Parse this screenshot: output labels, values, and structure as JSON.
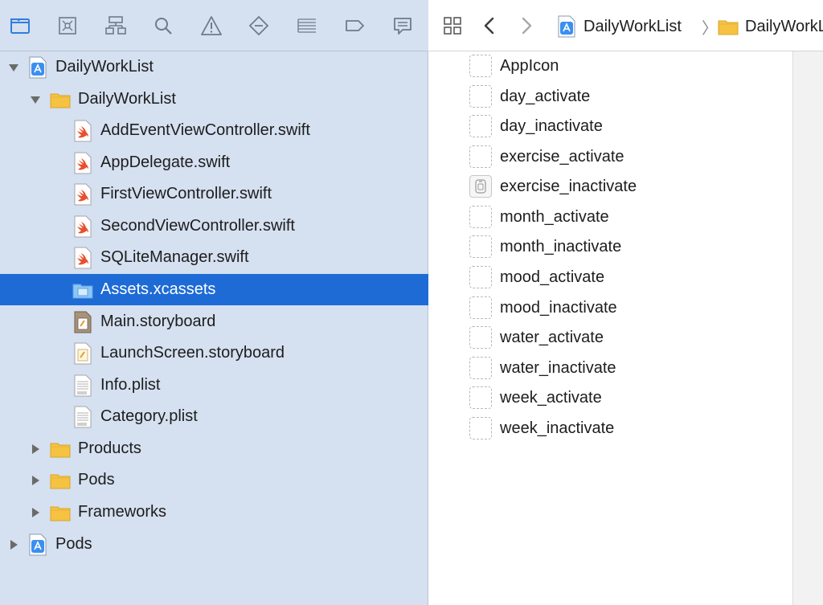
{
  "navigator": {
    "toolbar_icons": [
      "folder-icon",
      "source-control-icon",
      "hierarchy-icon",
      "search-icon",
      "warning-icon",
      "test-icon",
      "debug-icon",
      "breakpoint-icon",
      "report-icon"
    ],
    "tree": [
      {
        "label": "DailyWorkList",
        "icon": "xcode-project-icon",
        "disclosure": "expanded",
        "level": 0
      },
      {
        "label": "DailyWorkList",
        "icon": "folder-icon",
        "disclosure": "expanded",
        "level": 1
      },
      {
        "label": "AddEventViewController.swift",
        "icon": "swift-file-icon",
        "level": 2
      },
      {
        "label": "AppDelegate.swift",
        "icon": "swift-file-icon",
        "level": 2
      },
      {
        "label": "FirstViewController.swift",
        "icon": "swift-file-icon",
        "level": 2
      },
      {
        "label": "SecondViewController.swift",
        "icon": "swift-file-icon",
        "level": 2
      },
      {
        "label": "SQLiteManager.swift",
        "icon": "swift-file-icon",
        "level": 2
      },
      {
        "label": "Assets.xcassets",
        "icon": "asset-catalog-icon",
        "level": 2,
        "selected": true
      },
      {
        "label": "Main.storyboard",
        "icon": "storyboard-icon",
        "level": 2
      },
      {
        "label": "LaunchScreen.storyboard",
        "icon": "launch-storyboard-icon",
        "level": 2
      },
      {
        "label": "Info.plist",
        "icon": "plist-icon",
        "level": 2
      },
      {
        "label": "Category.plist",
        "icon": "plist-icon",
        "level": 2
      },
      {
        "label": "Products",
        "icon": "folder-icon",
        "disclosure": "collapsed",
        "level": 1
      },
      {
        "label": "Pods",
        "icon": "folder-icon",
        "disclosure": "collapsed",
        "level": 1
      },
      {
        "label": "Frameworks",
        "icon": "folder-icon",
        "disclosure": "collapsed",
        "level": 1
      },
      {
        "label": "Pods",
        "icon": "xcode-project-icon",
        "disclosure": "collapsed",
        "level": 0
      }
    ]
  },
  "jumpbar": {
    "crumbs": [
      {
        "label": "DailyWorkList",
        "icon": "xcode-project-icon"
      },
      {
        "label": "DailyWorkList",
        "icon": "folder-icon"
      }
    ],
    "separator": "〉"
  },
  "assets": [
    {
      "name": "AppIcon",
      "thumb": "empty"
    },
    {
      "name": "day_activate",
      "thumb": "empty"
    },
    {
      "name": "day_inactivate",
      "thumb": "empty"
    },
    {
      "name": "exercise_activate",
      "thumb": "empty"
    },
    {
      "name": "exercise_inactivate",
      "thumb": "image"
    },
    {
      "name": "month_activate",
      "thumb": "empty"
    },
    {
      "name": "month_inactivate",
      "thumb": "empty"
    },
    {
      "name": "mood_activate",
      "thumb": "empty"
    },
    {
      "name": "mood_inactivate",
      "thumb": "empty"
    },
    {
      "name": "water_activate",
      "thumb": "empty"
    },
    {
      "name": "water_inactivate",
      "thumb": "empty"
    },
    {
      "name": "week_activate",
      "thumb": "empty"
    },
    {
      "name": "week_inactivate",
      "thumb": "empty"
    }
  ],
  "colors": {
    "navigator_bg": "#d5e0f0",
    "selection": "#1e6bd6",
    "folder": "#f5c242",
    "swift": "#e94f2e",
    "accent": "#2f7de1"
  }
}
